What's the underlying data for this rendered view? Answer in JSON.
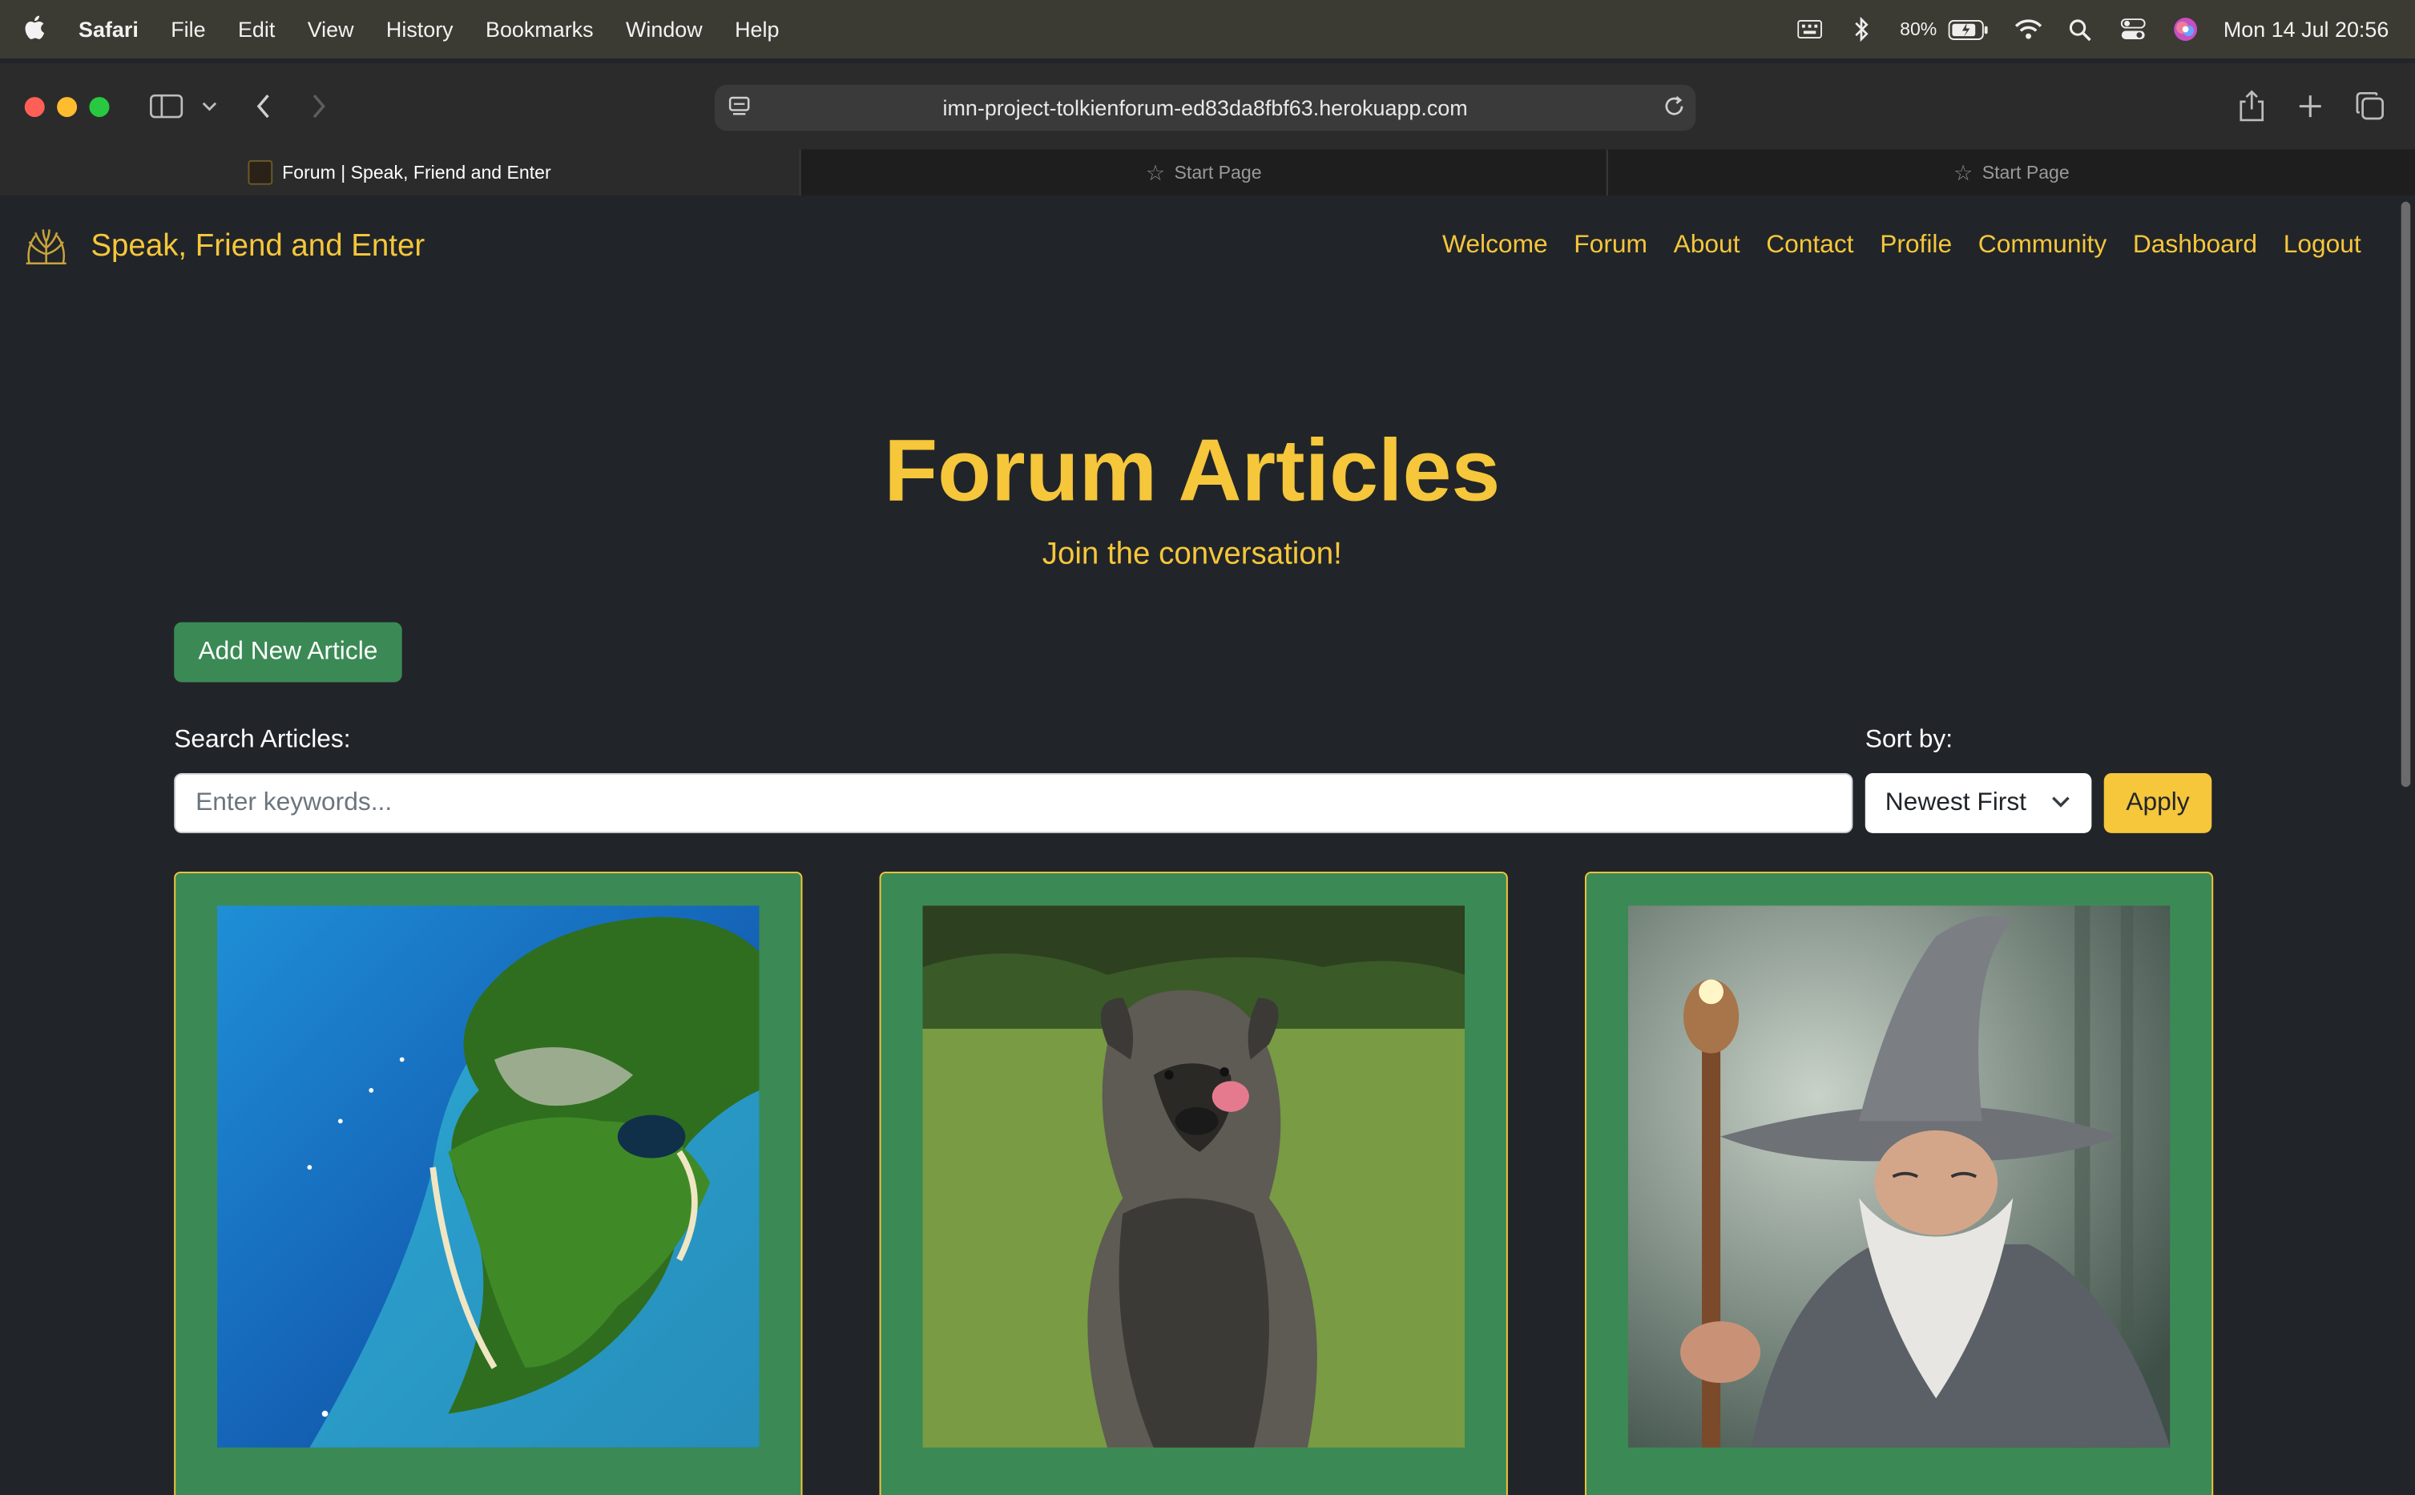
{
  "menubar": {
    "app_name": "Safari",
    "menus": [
      "File",
      "Edit",
      "View",
      "History",
      "Bookmarks",
      "Window",
      "Help"
    ],
    "battery_percent": "80%",
    "clock": "Mon 14 Jul  20:56"
  },
  "browser": {
    "url": "imn-project-tolkienforum-ed83da8fbf63.herokuapp.com",
    "tabs": [
      {
        "label": "Forum | Speak, Friend and Enter",
        "active": true
      },
      {
        "label": "Start Page",
        "active": false
      },
      {
        "label": "Start Page",
        "active": false
      }
    ]
  },
  "site": {
    "brand": "Speak, Friend and Enter",
    "nav": [
      "Welcome",
      "Forum",
      "About",
      "Contact",
      "Profile",
      "Community",
      "Dashboard",
      "Logout"
    ],
    "title": "Forum Articles",
    "subtitle": "Join the conversation!",
    "add_button": "Add New Article",
    "search_label": "Search Articles:",
    "search_placeholder": "Enter keywords...",
    "sort_label": "Sort by:",
    "sort_selected": "Newest First",
    "apply_button": "Apply",
    "cards": [
      {
        "image": "island-aerial-photo"
      },
      {
        "image": "dog-photo"
      },
      {
        "image": "wizard-illustration"
      }
    ]
  },
  "colors": {
    "accent": "#f6c63b",
    "green": "#3b8a55",
    "page_bg": "#212529"
  }
}
